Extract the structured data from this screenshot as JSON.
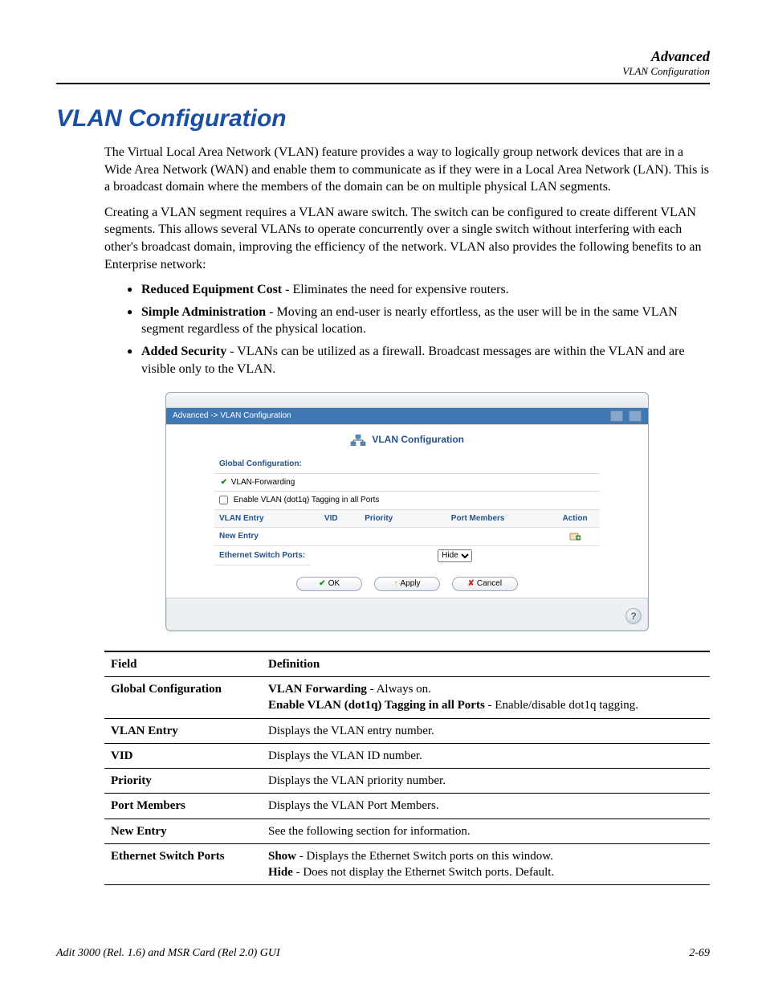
{
  "header": {
    "main": "Advanced",
    "sub": "VLAN Configuration"
  },
  "title": "VLAN Configuration",
  "para1": "The Virtual Local Area Network (VLAN) feature provides a way to logically group network devices that are in a Wide Area Network (WAN) and enable them to communicate as if they were in a Local Area Network (LAN). This is a broadcast domain where the members of the domain can be on multiple physical LAN segments.",
  "para2": "Creating a VLAN segment requires a VLAN aware switch. The switch can be configured to create different VLAN segments. This allows several VLANs to operate concurrently over a single switch without interfering with each other's broadcast domain, improving the efficiency of the network. VLAN also provides the following benefits to an Enterprise network:",
  "benefits": [
    {
      "bold": "Reduced Equipment Cost",
      "rest": " - Eliminates the need for expensive routers."
    },
    {
      "bold": "Simple Administration",
      "rest": " - Moving an end-user is nearly effortless, as the user will be in the same VLAN segment regardless of the physical location."
    },
    {
      "bold": "Added Security",
      "rest": " - VLANs can be utilized as a firewall. Broadcast messages are within the VLAN and are visible only to the VLAN."
    }
  ],
  "panel": {
    "breadcrumb": "Advanced -> VLAN Configuration",
    "title": "VLAN Configuration",
    "global_label": "Global Configuration:",
    "vlan_forwarding": "VLAN-Forwarding",
    "enable_dot1q": "Enable VLAN (dot1q) Tagging in all Ports",
    "cols": {
      "vlan_entry": "VLAN Entry",
      "vid": "VID",
      "priority": "Priority",
      "port_members": "Port Members",
      "action": "Action"
    },
    "new_entry": "New Entry",
    "eth_switch_ports": "Ethernet Switch Ports:",
    "hide_option": "Hide",
    "buttons": {
      "ok": "OK",
      "apply": "Apply",
      "cancel": "Cancel"
    },
    "help": "?"
  },
  "defs": {
    "head_field": "Field",
    "head_def": "Definition",
    "rows": [
      {
        "field": "Global Configuration",
        "b1": "VLAN Forwarding",
        "t1": " - Always on.",
        "b2": "Enable VLAN (dot1q) Tagging in all Ports",
        "t2": " - Enable/disable dot1q tagging."
      },
      {
        "field": "VLAN Entry",
        "def": "Displays the VLAN entry number."
      },
      {
        "field": "VID",
        "def": "Displays the VLAN ID number."
      },
      {
        "field": "Priority",
        "def": "Displays the VLAN priority number."
      },
      {
        "field": "Port Members",
        "def": "Displays the VLAN Port Members."
      },
      {
        "field": "New Entry",
        "def": "See the following section for information."
      },
      {
        "field": "Ethernet Switch Ports",
        "b1": "Show",
        "t1": " - Displays the Ethernet Switch ports on this window.",
        "b2": "Hide",
        "t2": " - Does not display the Ethernet Switch ports. Default."
      }
    ]
  },
  "footer": {
    "left": "Adit 3000 (Rel. 1.6) and MSR Card (Rel 2.0) GUI",
    "right": "2-69"
  }
}
